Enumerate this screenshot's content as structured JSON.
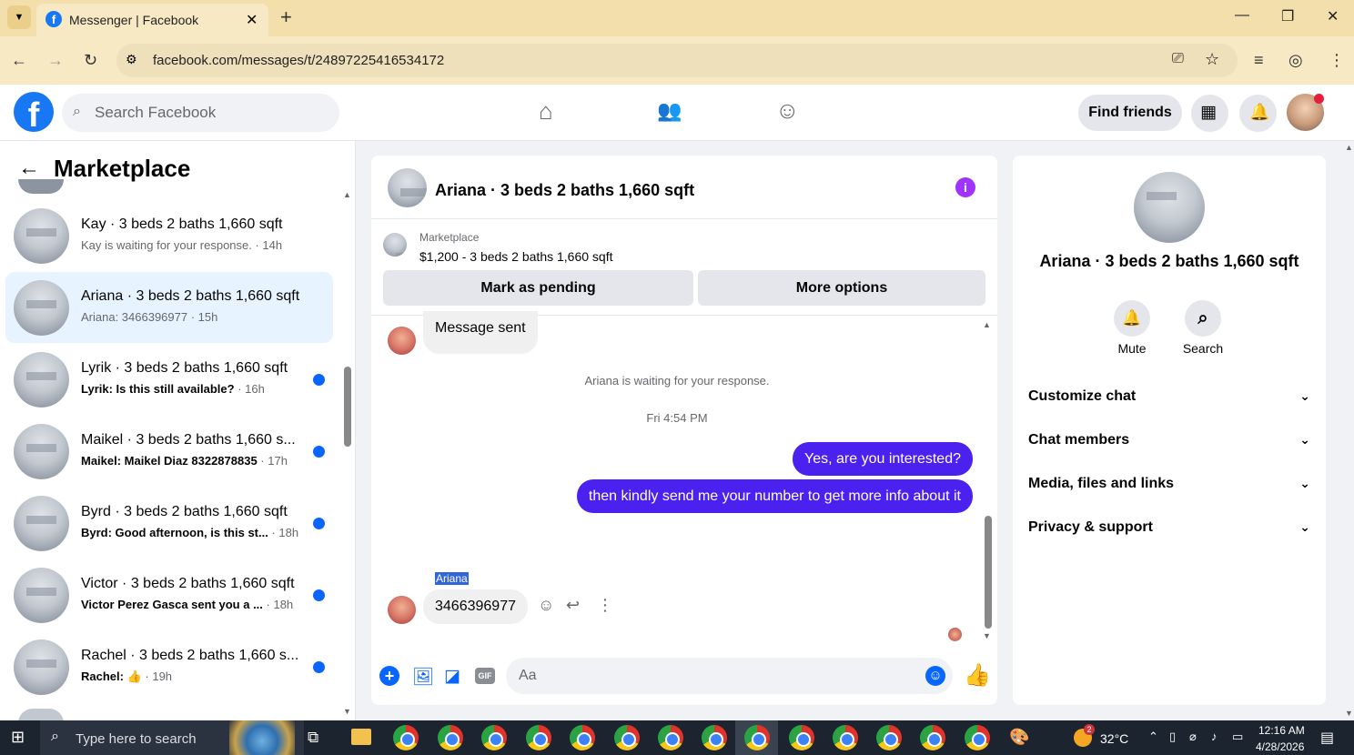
{
  "browser": {
    "tab_title": "Messenger | Facebook",
    "url": "facebook.com/messages/t/24897225416534172"
  },
  "header": {
    "search_placeholder": "Search Facebook",
    "find_friends": "Find friends"
  },
  "sidebar": {
    "title": "Marketplace",
    "conversations": [
      {
        "name": "Kay · 3 beds 2 baths 1,660 sqft",
        "preview": "Kay is waiting for your response. · 14h",
        "unread": false
      },
      {
        "name": "Ariana · 3 beds 2 baths 1,660 sqft",
        "preview": "Ariana: 3466396977 · 15h",
        "unread": false,
        "active": true
      },
      {
        "name": "Lyrik · 3 beds 2 baths 1,660 sqft",
        "preview_bold": "Lyrik: Is this still available?",
        "time": " · 16h",
        "unread": true
      },
      {
        "name": "Maikel · 3 beds 2 baths 1,660 s...",
        "preview_bold": "Maikel: Maikel Diaz 8322878835",
        "time": " · 17h",
        "unread": true
      },
      {
        "name": "Byrd · 3 beds 2 baths 1,660 sqft",
        "preview_bold": "Byrd: Good afternoon, is this st...",
        "time": " · 18h",
        "unread": true
      },
      {
        "name": "Victor · 3 beds 2 baths 1,660 sqft",
        "preview_bold": "Victor Perez Gasca sent you a ...",
        "time": " · 18h",
        "unread": true
      },
      {
        "name": "Rachel · 3 beds 2 baths 1,660 s...",
        "preview_bold": "Rachel:",
        "time": " · 19h",
        "unread": true
      }
    ]
  },
  "chat": {
    "title": "Ariana · 3 beds 2 baths 1,660 sqft",
    "listing_label": "Marketplace",
    "listing_price": "$1,200 - 3 beds 2 baths 1,660 sqft",
    "mark_pending": "Mark as pending",
    "more_options": "More options",
    "messages": {
      "sent_note": "Message sent",
      "waiting": "Ariana is waiting for your response.",
      "timestamp": "Fri 4:54 PM",
      "out1": "Yes, are you interested?",
      "out2": "then kindly send me your number to get more info about it",
      "sender_name": "Ariana",
      "in1": "3466396977"
    },
    "composer_placeholder": "Aa"
  },
  "info_panel": {
    "title": "Ariana · 3 beds 2 baths 1,660 sqft",
    "mute": "Mute",
    "search": "Search",
    "sections": [
      "Customize chat",
      "Chat members",
      "Media, files and links",
      "Privacy & support"
    ]
  },
  "taskbar": {
    "search_placeholder": "Type here to search",
    "temperature": "32°C",
    "time": "12:16 AM",
    "date": "4/28/2026",
    "weather_badge": "2"
  },
  "colors": {
    "brand": "#1877f2",
    "outgoing": "#4b21f0",
    "unread": "#0866ff",
    "info": "#a033ff"
  }
}
